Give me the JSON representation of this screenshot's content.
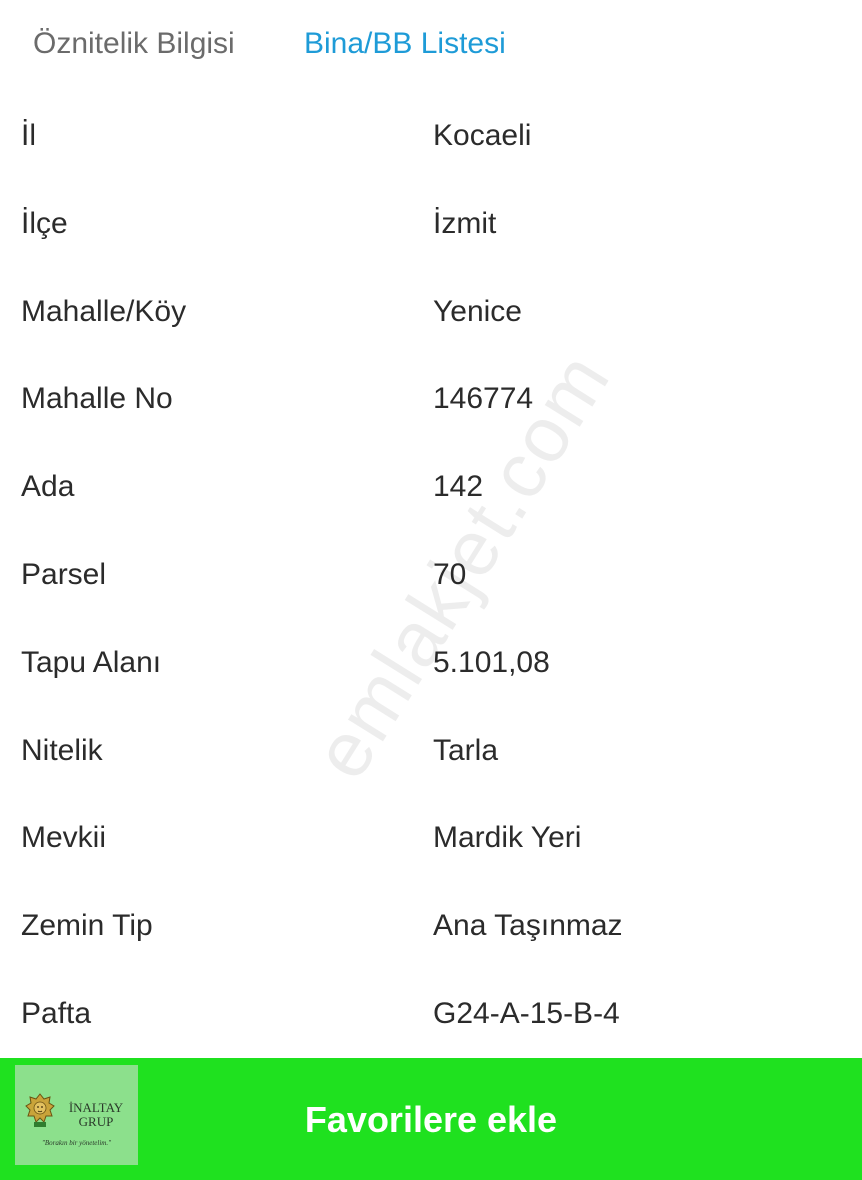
{
  "tabs": {
    "attributes": "Öznitelik Bilgisi",
    "building_list": "Bina/BB Listesi"
  },
  "rows": [
    {
      "label": "İl",
      "value": "Kocaeli"
    },
    {
      "label": "İlçe",
      "value": "İzmit"
    },
    {
      "label": "Mahalle/Köy",
      "value": "Yenice"
    },
    {
      "label": "Mahalle No",
      "value": "146774"
    },
    {
      "label": "Ada",
      "value": "142"
    },
    {
      "label": "Parsel",
      "value": "70"
    },
    {
      "label": "Tapu Alanı",
      "value": "5.101,08"
    },
    {
      "label": "Nitelik",
      "value": "Tarla"
    },
    {
      "label": "Mevkii",
      "value": "Mardik Yeri"
    },
    {
      "label": "Zemin Tip",
      "value": "Ana Taşınmaz"
    },
    {
      "label": "Pafta",
      "value": "G24-A-15-B-4"
    }
  ],
  "watermark": "emlakjet.com",
  "favorite": {
    "label": "Favorilere ekle"
  },
  "logo": {
    "name_line1": "İNALTAY",
    "name_line2": "GRUP",
    "slogan": "\"Borakın bir yönetelim.\"",
    "icon": "lion-icon"
  },
  "colors": {
    "tab_active": "#1e9bd7",
    "tab_inactive": "#6b6b6b",
    "favorite_bar": "#1fe11f"
  }
}
